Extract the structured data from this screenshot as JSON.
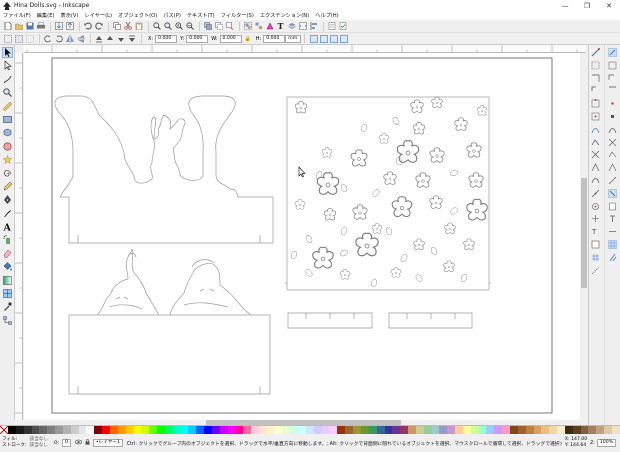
{
  "window": {
    "title": "Hina Dolls.svg - Inkscape",
    "minimize": "—",
    "maximize": "❐",
    "close": "✕"
  },
  "menu": [
    "ファイル(F)",
    "編集(E)",
    "表示(V)",
    "レイヤー(L)",
    "オブジェクト(O)",
    "パス(P)",
    "テキスト(T)",
    "フィルター(S)",
    "エクステンション(N)",
    "ヘルプ(H)"
  ],
  "controls": {
    "x_label": "X:",
    "x_value": "0.000",
    "y_label": "Y:",
    "y_value": "0.000",
    "w_label": "W:",
    "w_value": "0.000",
    "lock_label": "🔒",
    "h_label": "H:",
    "h_value": "0.000",
    "unit": "mm"
  },
  "status": {
    "fill_label": "フィル:",
    "stroke_label": "ストローク:",
    "fill_value": "該当なし",
    "stroke_value": "該当なし",
    "opacity_label": "O:",
    "opacity_value": "0",
    "layer_value": "•レイヤー1",
    "message": "Ctrl: クリックでグループ内のオブジェクトを選択、ドラッグで水平/垂直方向に移動します。; Alt: クリックで背面側に隠れているオブジェクトを選択、マウスクロールで循環して選択、ドラッグで選択オブ",
    "x_coord": "X: 147.00",
    "y_coord": "Y: 144.64",
    "zoom_label": "Z:",
    "zoom_value": "100%"
  },
  "colors": {
    "accent": "#3a78c9",
    "canvas": "#ffffff",
    "outline": "#a0a0a0"
  },
  "palette": [
    "#000000",
    "#1a1a1a",
    "#333333",
    "#4d4d4d",
    "#666666",
    "#808080",
    "#999999",
    "#b3b3b3",
    "#cccccc",
    "#e6e6e6",
    "#ffffff",
    "#800000",
    "#ff0000",
    "#ff6600",
    "#ff9900",
    "#ffcc00",
    "#ffff00",
    "#ccff00",
    "#66ff00",
    "#00ff00",
    "#00ff66",
    "#00ffcc",
    "#00ffff",
    "#00ccff",
    "#0066ff",
    "#0000ff",
    "#6600ff",
    "#cc00ff",
    "#ff00ff",
    "#ff0099",
    "#ff6699",
    "#ffccdd",
    "#ffe6cc",
    "#fff2cc",
    "#ffffcc",
    "#e6ffcc",
    "#ccffe6",
    "#ccffff",
    "#cce6ff",
    "#ccccff",
    "#e6ccff",
    "#ffccff",
    "#993300",
    "#996633",
    "#999933",
    "#669933",
    "#339966",
    "#336699",
    "#333399",
    "#663399",
    "#993366",
    "#cc9966",
    "#cccc99",
    "#99cc99",
    "#99cccc",
    "#9999cc",
    "#cc99cc",
    "#ffcc99",
    "#ffff99",
    "#ccff99",
    "#99ffcc",
    "#99ccff",
    "#cc99ff",
    "#ff99cc",
    "#7a4a1a",
    "#a06030",
    "#c08040",
    "#d8a060",
    "#e8c080",
    "#f0d8a8",
    "#f8ecd0",
    "#3a2a10",
    "#5a4020",
    "#806040",
    "#a08060",
    "#c0a080",
    "#e0c8a8",
    "#f0e0c8"
  ]
}
